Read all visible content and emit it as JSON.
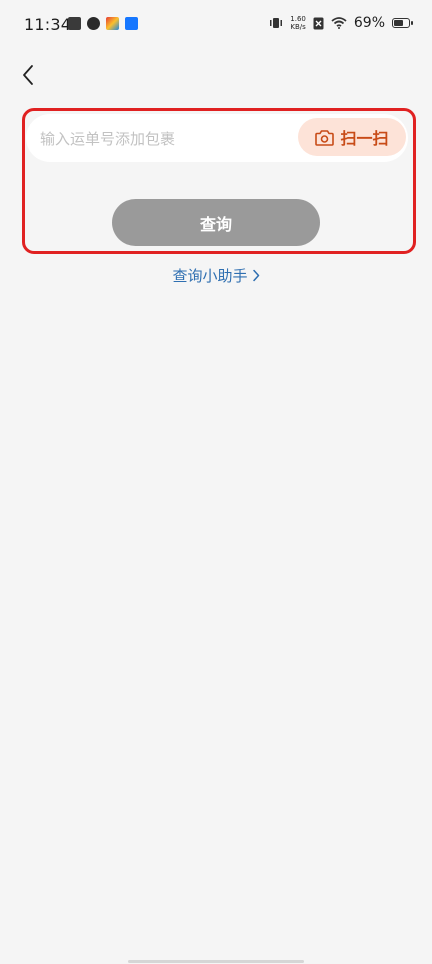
{
  "status_bar": {
    "time": "11:34",
    "net_speed_value": "1.60",
    "net_speed_unit": "KB/s",
    "battery_percent": "69%",
    "battery_level": 0.69
  },
  "query": {
    "input_placeholder": "输入运单号添加包裹",
    "input_value": "",
    "scan_label": "扫一扫",
    "query_label": "查询"
  },
  "helper": {
    "label": "查询小助手"
  },
  "colors": {
    "scan_accent": "#c84b17",
    "highlight_border": "#e02121",
    "link": "#2f6fb1",
    "query_button": "#9a9a9a"
  }
}
